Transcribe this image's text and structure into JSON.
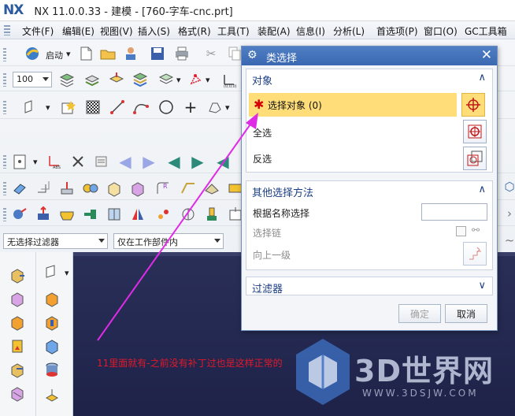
{
  "window": {
    "app_logo": "NX",
    "title": "NX 11.0.0.33 - 建模 - [760-字车-cnc.prt]"
  },
  "menu": {
    "items": [
      "文件(F)",
      "编辑(E)",
      "视图(V)",
      "插入(S)",
      "格式(R)",
      "工具(T)",
      "装配(A)",
      "信息(I)",
      "分析(L)",
      "首选项(P)",
      "窗口(O)",
      "GC工具箱"
    ]
  },
  "toolbar": {
    "start_label": "启动",
    "zoom_value": "100",
    "filter_combo": "无选择过滤器",
    "scope_combo": "仅在工作部件内"
  },
  "dialog": {
    "title": "类选择",
    "object_group": {
      "header": "对象",
      "select_object": "选择对象 (0)",
      "select_all": "全选",
      "invert": "反选"
    },
    "other_methods_group": {
      "header": "其他选择方法",
      "select_by_name": "根据名称选择",
      "select_chain": "选择链",
      "up_one_level": "向上一级"
    },
    "filter_group": {
      "header": "过滤器"
    },
    "buttons": {
      "ok": "确定",
      "cancel": "取消"
    }
  },
  "graphics": {
    "annotation": "11里面就有-之前没有补丁过也是这样正常的",
    "watermark": "3D世界网",
    "watermark_url": "WWW.3DSJW.COM"
  },
  "colors": {
    "accent_blue": "#3a69b2",
    "selection_yellow": "#ffde7a",
    "annotation_red": "#e0192a",
    "arrow_magenta": "#e02be6",
    "graphics_bg": "#242a52"
  }
}
